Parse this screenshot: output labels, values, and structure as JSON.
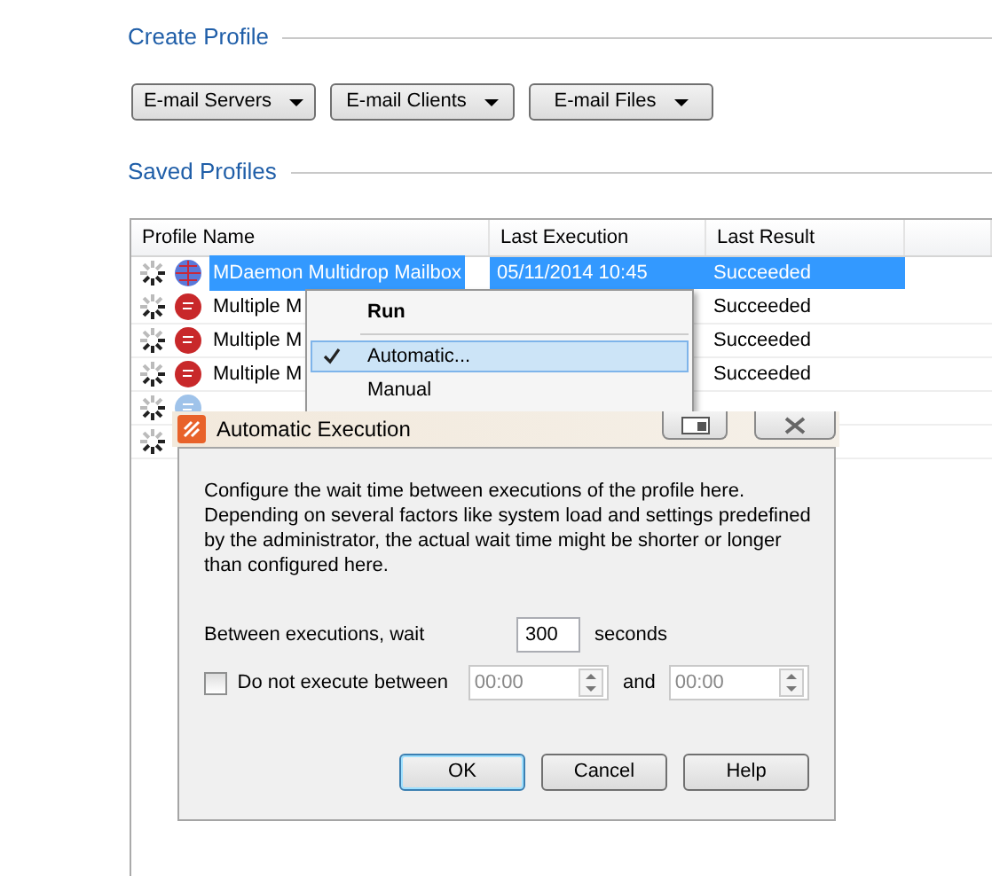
{
  "sections": [
    {
      "title": "Create Profile"
    },
    {
      "title": "Saved Profiles"
    }
  ],
  "create_buttons": [
    "E-mail Servers",
    "E-mail Clients",
    "E-mail Files"
  ],
  "table": {
    "columns": [
      "Profile Name",
      "Last Execution",
      "Last Result"
    ],
    "rows": [
      {
        "kind": "globe",
        "name": "MDaemon Multidrop Mailbox",
        "last_execution": "05/11/2014 10:45",
        "last_result": "Succeeded",
        "selected": true
      },
      {
        "kind": "mail",
        "name": "Multiple M",
        "last_result": "Succeeded",
        "selected": false
      },
      {
        "kind": "mail",
        "name": "Multiple M",
        "last_result": "Succeeded",
        "selected": false
      },
      {
        "kind": "mail",
        "name": "Multiple M",
        "last_result": "Succeeded",
        "selected": false
      },
      {
        "kind": "folder",
        "selected": false
      },
      {
        "kind": "blank",
        "selected": false
      }
    ]
  },
  "context_menu": {
    "items": [
      {
        "kind": "command",
        "label": "Run",
        "checked": false,
        "selected": false
      },
      {
        "kind": "separator"
      },
      {
        "kind": "command",
        "label": "Automatic...",
        "checked": true,
        "selected": true
      },
      {
        "kind": "command",
        "label": "Manual",
        "checked": false,
        "selected": false
      }
    ]
  },
  "dialog": {
    "title": "Automatic Execution",
    "description": "Configure the wait time between executions of the profile here. Depending on several factors like system load and settings predefined by the administrator, the actual wait time might be shorter or longer than configured here.",
    "wait_label": "Between executions, wait",
    "wait_value": "300",
    "wait_unit": "seconds",
    "exclude": {
      "label": "Do not execute between",
      "checked": false,
      "from": "00:00",
      "and_label": "and",
      "to": "00:00"
    },
    "buttons": [
      {
        "label": "OK",
        "default": true
      },
      {
        "label": "Cancel",
        "default": false
      },
      {
        "label": "Help",
        "default": false
      }
    ]
  }
}
